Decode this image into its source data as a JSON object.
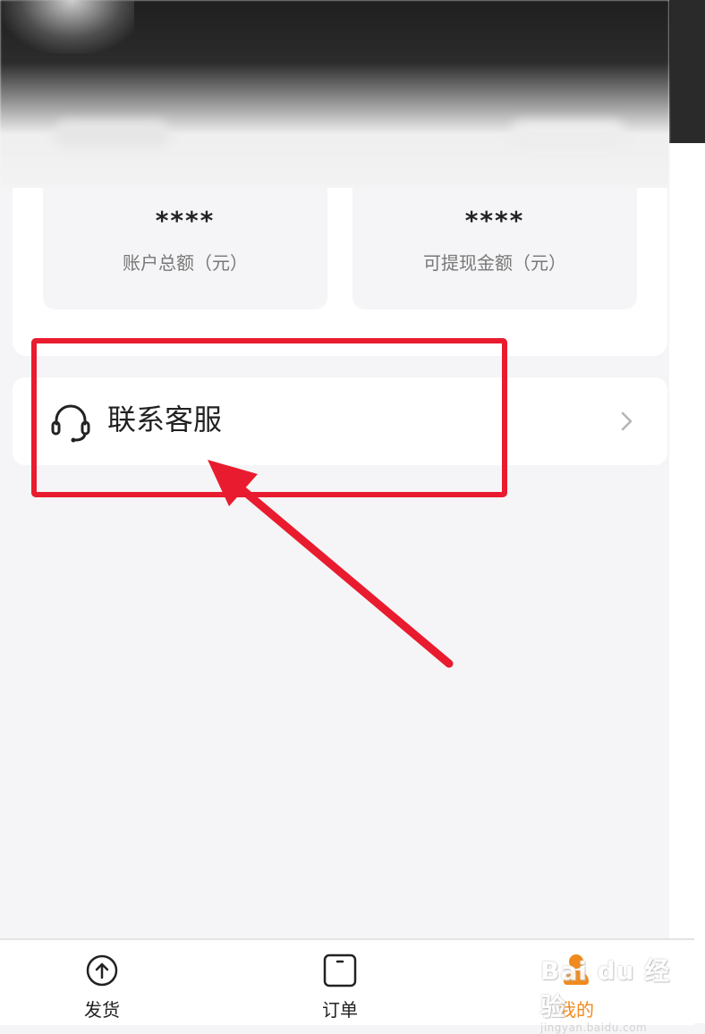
{
  "balance": {
    "total": {
      "value": "****",
      "label": "账户总额（元）"
    },
    "withdrawable": {
      "value": "****",
      "label": "可提现金额（元）"
    }
  },
  "service": {
    "label": "联系客服",
    "icon": "headset-icon"
  },
  "annotation": {
    "color": "#e81c2e"
  },
  "tabbar": {
    "tabs": [
      {
        "label": "发货",
        "icon": "upload-circle-icon",
        "active": false
      },
      {
        "label": "订单",
        "icon": "order-icon",
        "active": false
      },
      {
        "label": "我的",
        "icon": "user-icon",
        "active": true
      }
    ],
    "active_color": "#f08a1e"
  },
  "watermark": {
    "main": "Bai du 经验",
    "sub": "jingyan.baidu.com"
  }
}
